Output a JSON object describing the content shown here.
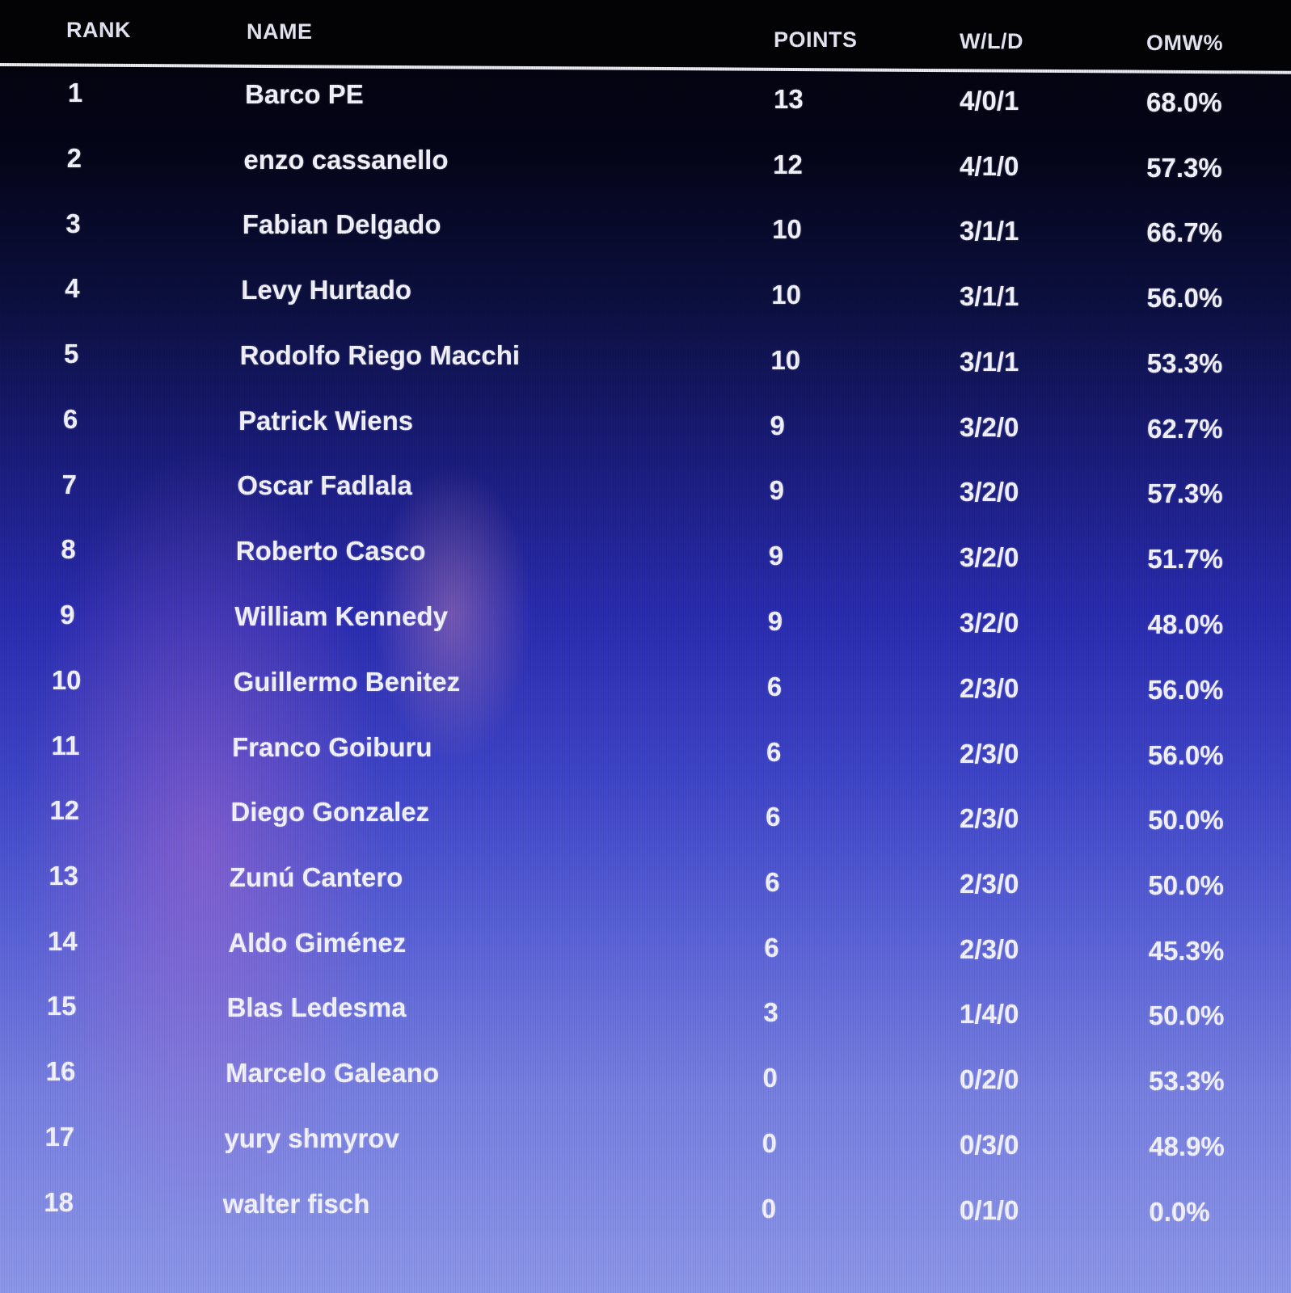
{
  "table": {
    "columns": {
      "rank": "RANK",
      "name": "NAME",
      "points": "POINTS",
      "wld": "W/L/D",
      "omw": "OMW%"
    },
    "rows": [
      {
        "rank": "1",
        "name": "Barco PE",
        "points": "13",
        "wld": "4/0/1",
        "omw": "68.0%"
      },
      {
        "rank": "2",
        "name": "enzo cassanello",
        "points": "12",
        "wld": "4/1/0",
        "omw": "57.3%"
      },
      {
        "rank": "3",
        "name": "Fabian Delgado",
        "points": "10",
        "wld": "3/1/1",
        "omw": "66.7%"
      },
      {
        "rank": "4",
        "name": "Levy Hurtado",
        "points": "10",
        "wld": "3/1/1",
        "omw": "56.0%"
      },
      {
        "rank": "5",
        "name": "Rodolfo Riego Macchi",
        "points": "10",
        "wld": "3/1/1",
        "omw": "53.3%"
      },
      {
        "rank": "6",
        "name": "Patrick Wiens",
        "points": "9",
        "wld": "3/2/0",
        "omw": "62.7%"
      },
      {
        "rank": "7",
        "name": "Oscar Fadlala",
        "points": "9",
        "wld": "3/2/0",
        "omw": "57.3%"
      },
      {
        "rank": "8",
        "name": "Roberto Casco",
        "points": "9",
        "wld": "3/2/0",
        "omw": "51.7%"
      },
      {
        "rank": "9",
        "name": "William Kennedy",
        "points": "9",
        "wld": "3/2/0",
        "omw": "48.0%"
      },
      {
        "rank": "10",
        "name": "Guillermo Benitez",
        "points": "6",
        "wld": "2/3/0",
        "omw": "56.0%"
      },
      {
        "rank": "11",
        "name": "Franco Goiburu",
        "points": "6",
        "wld": "2/3/0",
        "omw": "56.0%"
      },
      {
        "rank": "12",
        "name": "Diego Gonzalez",
        "points": "6",
        "wld": "2/3/0",
        "omw": "50.0%"
      },
      {
        "rank": "13",
        "name": "Zunú Cantero",
        "points": "6",
        "wld": "2/3/0",
        "omw": "50.0%"
      },
      {
        "rank": "14",
        "name": "Aldo Giménez",
        "points": "6",
        "wld": "2/3/0",
        "omw": "45.3%"
      },
      {
        "rank": "15",
        "name": "Blas Ledesma",
        "points": "3",
        "wld": "1/4/0",
        "omw": "50.0%"
      },
      {
        "rank": "16",
        "name": "Marcelo Galeano",
        "points": "0",
        "wld": "0/2/0",
        "omw": "53.3%"
      },
      {
        "rank": "17",
        "name": "yury shmyrov",
        "points": "0",
        "wld": "0/3/0",
        "omw": "48.9%"
      },
      {
        "rank": "18",
        "name": "walter fisch",
        "points": "0",
        "wld": "0/1/0",
        "omw": "0.0%"
      }
    ]
  }
}
